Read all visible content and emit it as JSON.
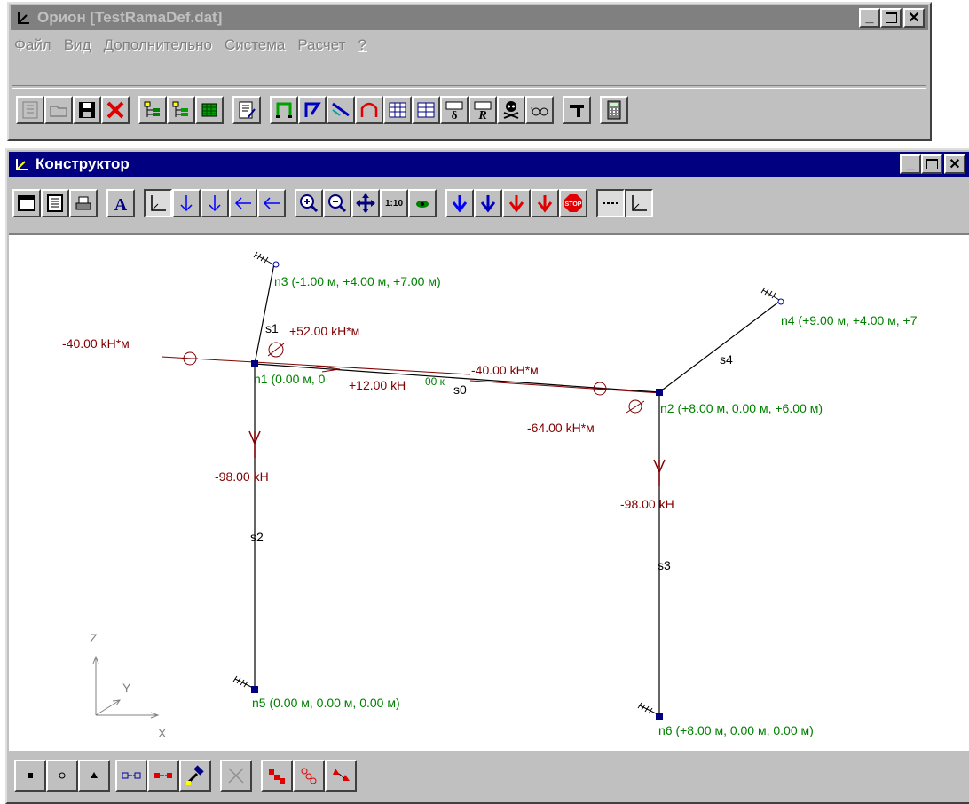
{
  "orion_window": {
    "title": "Орион [TestRamaDef.dat]",
    "menu": [
      "Файл",
      "Вид",
      "Дополнительно",
      "Система",
      "Расчет",
      "?"
    ],
    "toolbar_icons": [
      "new-icon",
      "open-icon",
      "save-icon",
      "delete-icon",
      "tree-icon",
      "tree2-icon",
      "table-icon",
      "edit-icon",
      "frame-icon",
      "frame-corner-icon",
      "beam-icon",
      "arch-icon",
      "grid-icon",
      "grid2-icon",
      "delta-icon",
      "r-icon",
      "skull-icon",
      "glasses-icon",
      "hammer-icon",
      "calculator-icon"
    ]
  },
  "constructor_window": {
    "title": "Конструктор",
    "toolbar_icons": [
      "window-icon",
      "print-preview-icon",
      "print-icon",
      "font-icon",
      "axes-icon",
      "load-down-icon",
      "load-down2-icon",
      "load-left-icon",
      "load-left2-icon",
      "zoom-in-icon",
      "zoom-out-icon",
      "pan-icon",
      "scale-icon",
      "eye-icon",
      "blue-arrow-icon",
      "blue-arrow2-icon",
      "red-arrow-icon",
      "red-arrow2-icon",
      "stop-icon",
      "dash-icon",
      "axes2-icon"
    ],
    "scale_label": "1:10",
    "stop_label": "STOP"
  },
  "drawing": {
    "nodes": {
      "n1": "n1 (0.00 м, 0",
      "n2": "n2 (+8.00 м, 0.00 м, +6.00 м)",
      "n3": "n3 (-1.00 м, +4.00 м, +7.00 м)",
      "n4": "n4 (+9.00 м, +4.00 м, +7",
      "n5": "n5 (0.00 м, 0.00 м, 0.00 м)",
      "n6": "n6 (+8.00 м, 0.00 м, 0.00 м)"
    },
    "segments": [
      "s0",
      "s1",
      "s2",
      "s3",
      "s4"
    ],
    "loads": {
      "m_n1_left": "-40.00 kH*м",
      "m_n1_top": "+52.00 kH*м",
      "m_n1_mid": "+12.00 kH",
      "m_s0_overlap": "00 к",
      "m_n2_left": "-40.00 kH*м",
      "m_n2_bottom": "-64.00 kH*м",
      "f_s2": "-98.00 kH",
      "f_s3": "-98.00 kH"
    },
    "axes": {
      "z": "Z",
      "y": "Y",
      "x": "X"
    }
  },
  "bottom_toolbar": {
    "icons": [
      "node-square-icon",
      "node-circle-icon",
      "node-triangle-icon",
      "link-icon",
      "link-red-icon",
      "hammer-icon",
      "cross-icon",
      "red-blocks-icon",
      "red-chain-icon",
      "red-triangles-icon"
    ]
  },
  "colors": {
    "title_active": "#000080",
    "title_inactive": "#808080",
    "node_label": "#008000",
    "load": "#800000"
  }
}
